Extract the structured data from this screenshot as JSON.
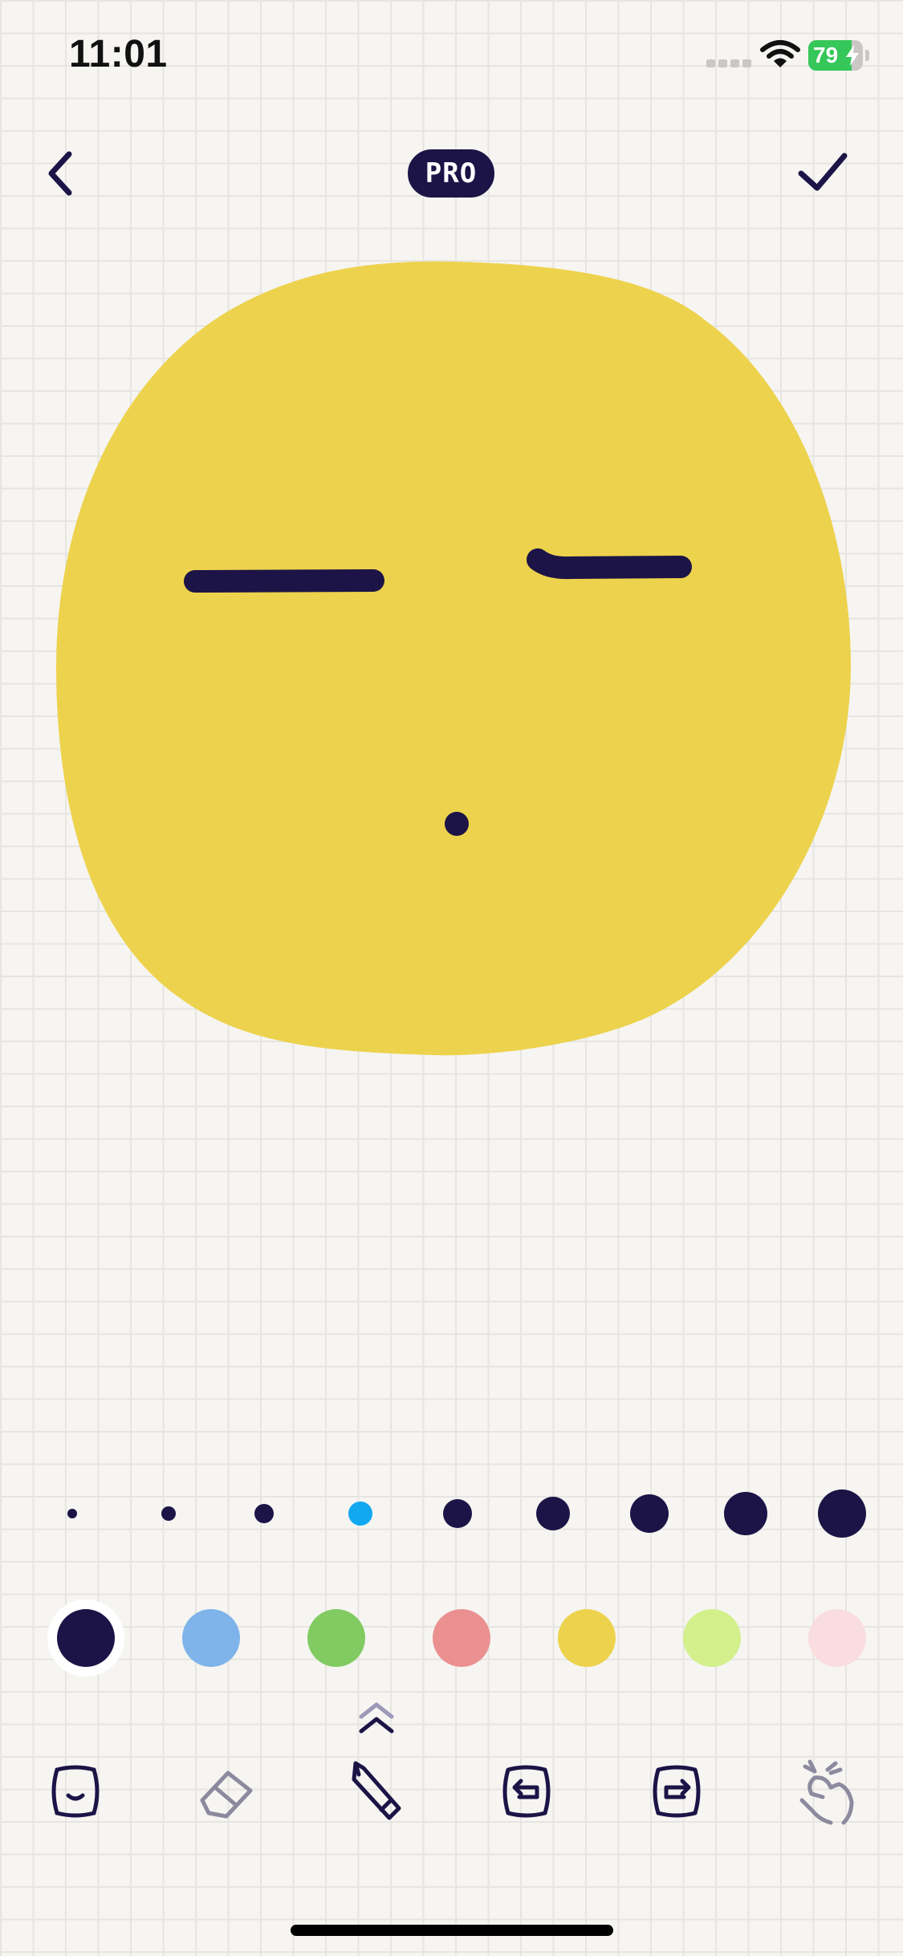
{
  "status_bar": {
    "time": "11:01",
    "battery_percent": "79",
    "battery_level": 0.79,
    "charging": true,
    "icons": [
      "cellular-signal-icon",
      "wifi-icon",
      "battery-icon"
    ]
  },
  "nav": {
    "back_icon": "chevron-left-icon",
    "badge": "PRO",
    "done_icon": "checkmark-icon"
  },
  "canvas": {
    "face_fill": "#edd24d",
    "stroke_color": "#1c1446",
    "strokes": [
      "left-eye",
      "right-eye",
      "mouth-dot"
    ]
  },
  "brush_sizes": {
    "count": 9,
    "selected_index": 3,
    "selected_color": "#12a8f0",
    "default_color": "#1c1446"
  },
  "palette": {
    "selected_index": 0,
    "colors": [
      "#1c1446",
      "#7eb4ea",
      "#82cb62",
      "#eb9090",
      "#edd24d",
      "#d4f08d",
      "#fadddf"
    ]
  },
  "toolbar": {
    "expand_icon": "double-chevron-up-icon",
    "tools": [
      {
        "id": "face",
        "icon": "face-sticker-icon",
        "active": true
      },
      {
        "id": "eraser",
        "icon": "eraser-icon",
        "active": false
      },
      {
        "id": "pencil",
        "icon": "pencil-icon",
        "active": true
      },
      {
        "id": "undo",
        "icon": "undo-icon",
        "active": true
      },
      {
        "id": "redo",
        "icon": "redo-icon",
        "active": true
      },
      {
        "id": "pinch",
        "icon": "pinch-gesture-icon",
        "active": false
      }
    ],
    "active_color": "#1c1446",
    "inactive_color": "#8c8a9e"
  }
}
